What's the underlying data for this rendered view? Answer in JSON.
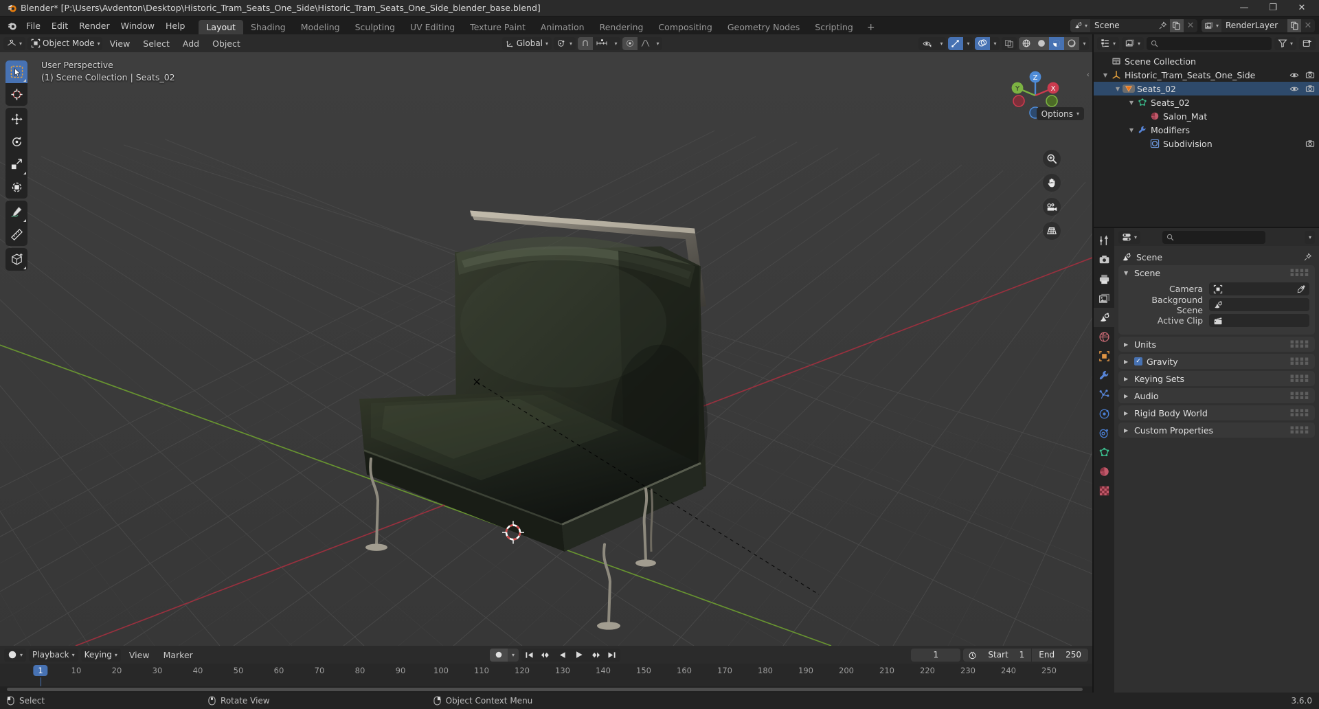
{
  "window": {
    "title": "Blender* [P:\\Users\\Avdenton\\Desktop\\Historic_Tram_Seats_One_Side\\Historic_Tram_Seats_One_Side_blender_base.blend]",
    "minimize": "—",
    "maximize": "❐",
    "close": "✕"
  },
  "menu": {
    "items": [
      "File",
      "Edit",
      "Render",
      "Window",
      "Help"
    ]
  },
  "workspaces": {
    "tabs": [
      "Layout",
      "Shading",
      "Modeling",
      "Sculpting",
      "UV Editing",
      "Texture Paint",
      "Animation",
      "Rendering",
      "Compositing",
      "Geometry Nodes",
      "Scripting"
    ],
    "active": "Layout",
    "add": "+"
  },
  "topbar_right": {
    "scene_name": "Scene",
    "viewlayer_name": "RenderLayer"
  },
  "viewport_header": {
    "mode": "Object Mode",
    "menus": [
      "View",
      "Select",
      "Add",
      "Object"
    ],
    "transform_orientation": "Global",
    "options_label": "Options"
  },
  "viewport": {
    "perspective_label": "User Perspective",
    "context_label": "(1) Scene Collection | Seats_02",
    "gizmo_axes": {
      "x": "X",
      "y": "Y",
      "z": "Z"
    },
    "colors": {
      "bg_top": "#3b3b3b",
      "bg_bottom": "#393939",
      "grid_line": "#4c4c4c",
      "axis_x": "#a33c4a",
      "axis_y": "#6b9a30",
      "axis_z": "#3e7ec4",
      "accent_blue": "#4772b3"
    }
  },
  "outliner": {
    "rows": [
      {
        "label": "Scene Collection",
        "indent": 0,
        "icon": "collection-icon",
        "disclosure": "",
        "visibility": false,
        "selected": false
      },
      {
        "label": "Historic_Tram_Seats_One_Side",
        "indent": 1,
        "icon": "empty-axes-icon",
        "disclosure": "down",
        "visibility": true,
        "selected": false
      },
      {
        "label": "Seats_02",
        "indent": 2,
        "icon": "object-mesh-icon",
        "disclosure": "down",
        "visibility": true,
        "selected": true
      },
      {
        "label": "Seats_02",
        "indent": 3,
        "icon": "mesh-data-icon",
        "disclosure": "down",
        "visibility": false,
        "selected": false
      },
      {
        "label": "Salon_Mat",
        "indent": 4,
        "icon": "material-icon",
        "disclosure": "",
        "visibility": false,
        "selected": false
      },
      {
        "label": "Modifiers",
        "indent": 3,
        "icon": "wrench-icon",
        "disclosure": "down",
        "visibility": false,
        "selected": false
      },
      {
        "label": "Subdivision",
        "indent": 4,
        "icon": "subdivision-icon",
        "disclosure": "",
        "visibility": false,
        "camera_only": true,
        "selected": false
      }
    ],
    "search_placeholder": ""
  },
  "properties": {
    "breadcrumb": "Scene",
    "search_placeholder": "",
    "panels": [
      {
        "id": "scene",
        "title": "Scene",
        "open": true,
        "checkbox": null
      },
      {
        "id": "units",
        "title": "Units",
        "open": false,
        "checkbox": null
      },
      {
        "id": "gravity",
        "title": "Gravity",
        "open": false,
        "checkbox": true
      },
      {
        "id": "keying_sets",
        "title": "Keying Sets",
        "open": false,
        "checkbox": null
      },
      {
        "id": "audio",
        "title": "Audio",
        "open": false,
        "checkbox": null
      },
      {
        "id": "rigid_body_world",
        "title": "Rigid Body World",
        "open": false,
        "checkbox": null
      },
      {
        "id": "custom_properties",
        "title": "Custom Properties",
        "open": false,
        "checkbox": null
      }
    ],
    "scene_fields": [
      {
        "label": "Camera",
        "value": "",
        "icon": "camera-data-icon",
        "eyedropper": true
      },
      {
        "label": "Background Scene",
        "value": "",
        "icon": "scene-icon",
        "eyedropper": false
      },
      {
        "label": "Active Clip",
        "value": "",
        "icon": "clip-icon",
        "eyedropper": false
      }
    ],
    "tabs": [
      "tool-icon",
      "render-icon",
      "output-icon",
      "view-layer-icon",
      "scene-icon",
      "world-icon",
      "object-icon",
      "modifier-icon",
      "particles-icon",
      "physics-icon",
      "constraints-icon",
      "data-icon",
      "material-icon",
      "texture-icon"
    ],
    "active_tab": "scene-icon"
  },
  "timeline": {
    "editor_menus": [
      "Playback",
      "Keying",
      "View",
      "Marker"
    ],
    "ticks": [
      10,
      20,
      30,
      40,
      50,
      60,
      70,
      80,
      90,
      100,
      110,
      120,
      130,
      140,
      150,
      160,
      170,
      180,
      190,
      200,
      210,
      220,
      230,
      240,
      250
    ],
    "current_frame": "1",
    "current_frame_field": "1",
    "start_label": "Start",
    "start_value": "1",
    "end_label": "End",
    "end_value": "250"
  },
  "statusbar": {
    "items": [
      {
        "label": "Select",
        "icon": "mouse-left-icon"
      },
      {
        "label": "Rotate View",
        "icon": "mouse-middle-icon"
      },
      {
        "label": "Object Context Menu",
        "icon": "mouse-right-icon"
      }
    ],
    "version": "3.6.0"
  }
}
